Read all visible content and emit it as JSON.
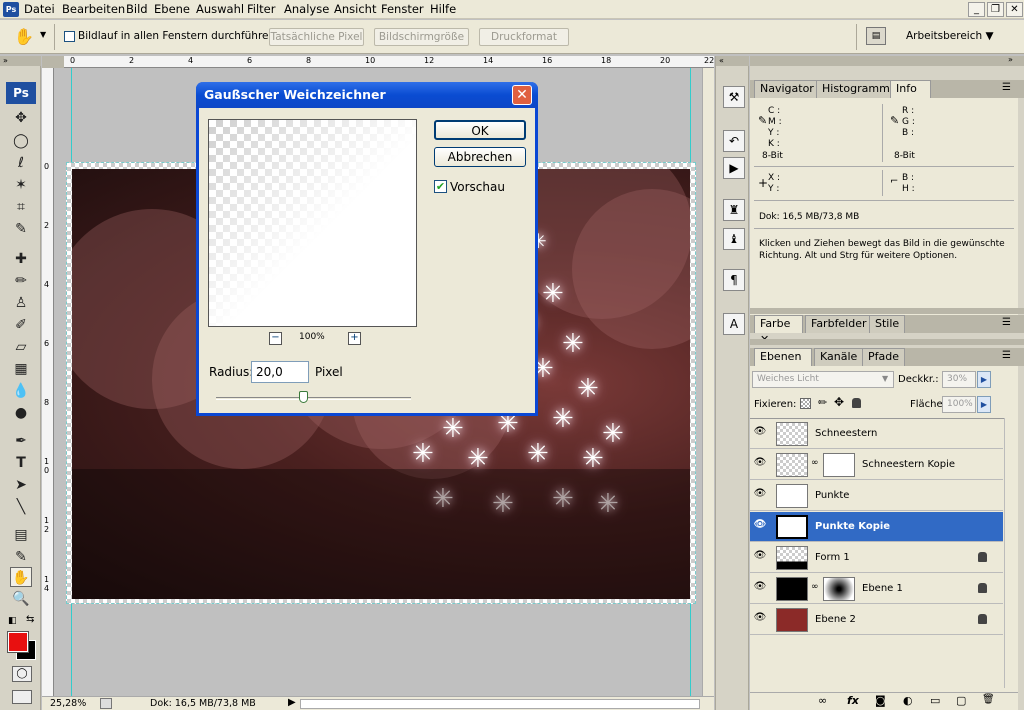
{
  "menubar": {
    "items": [
      "Datei",
      "Bearbeiten",
      "Bild",
      "Ebene",
      "Auswahl",
      "Filter",
      "Analyse",
      "Ansicht",
      "Fenster",
      "Hilfe"
    ],
    "window_buttons": [
      "_",
      "❐",
      "✕"
    ]
  },
  "options": {
    "scroll_all_label": "Bildlauf in allen Fenstern durchführen",
    "buttons": [
      "Tatsächliche Pixel",
      "Bildschirmgröße",
      "Druckformat"
    ],
    "workspace_label": "Arbeitsbereich ▼"
  },
  "rulers": {
    "horizontal": [
      "0",
      "2",
      "4",
      "6",
      "8",
      "10",
      "12",
      "14",
      "16",
      "18",
      "20",
      "22"
    ],
    "vertical": [
      "0",
      "2",
      "4",
      "6",
      "8",
      "1\n0",
      "1\n2",
      "1\n4"
    ]
  },
  "status": {
    "zoom": "25,28%",
    "doc": "Dok: 16,5 MB/73,8 MB"
  },
  "dialog": {
    "title": "Gaußscher Weichzeichner",
    "ok": "OK",
    "cancel": "Abbrechen",
    "preview_label": "Vorschau",
    "preview_checked": true,
    "zoom_minus": "−",
    "zoom_value": "100%",
    "zoom_plus": "+",
    "radius_label": "Radius:",
    "radius_value": "20,0",
    "radius_unit": "Pixel",
    "radius_slider_fraction": 0.45
  },
  "info_panel": {
    "tabs": [
      "Navigator",
      "Histogramm",
      "Info"
    ],
    "cmyk_labels": [
      "C :",
      "M :",
      "Y :",
      "K :"
    ],
    "rgb_labels": [
      "R :",
      "G :",
      "B :"
    ],
    "bit_left": "8-Bit",
    "bit_right": "8-Bit",
    "xy_labels": [
      "X :",
      "Y :"
    ],
    "bh_labels": [
      "B :",
      "H :"
    ],
    "doc": "Dok: 16,5 MB/73,8 MB",
    "hint": "Klicken und Ziehen bewegt das Bild in die gewünschte Richtung. Alt und Strg für weitere Optionen."
  },
  "color_panel": {
    "tabs": [
      "Farbe",
      "Farbfelder",
      "Stile"
    ]
  },
  "layers_panel": {
    "tabs": [
      "Ebenen",
      "Kanäle",
      "Pfade"
    ],
    "blend_mode": "Weiches Licht",
    "opacity_label": "Deckkr.:",
    "opacity_value": "30%",
    "lock_label": "Fixieren:",
    "fill_label": "Fläche:",
    "fill_value": "100%",
    "layers": [
      {
        "name": "Schneestern",
        "selected": false,
        "mask": false,
        "locked": false
      },
      {
        "name": "Schneestern Kopie",
        "selected": false,
        "mask": true,
        "locked": false
      },
      {
        "name": "Punkte",
        "selected": false,
        "mask": false,
        "locked": false
      },
      {
        "name": "Punkte Kopie",
        "selected": true,
        "mask": false,
        "locked": false
      },
      {
        "name": "Form 1",
        "selected": false,
        "mask": false,
        "locked": true
      },
      {
        "name": "Ebene 1",
        "selected": false,
        "mask": true,
        "locked": true
      },
      {
        "name": "Ebene 2",
        "selected": false,
        "mask": false,
        "locked": true
      }
    ],
    "footer_icons": [
      "link-icon",
      "fx-icon",
      "mask-icon",
      "adjustment-icon",
      "folder-icon",
      "new-layer-icon",
      "trash-icon"
    ],
    "footer_glyphs": [
      "∞",
      "fx",
      "◙",
      "◐",
      "▭",
      "▢",
      "🗑"
    ]
  },
  "colors": {
    "foreground": "#e81010",
    "background": "#000000",
    "selection": "#316ac5",
    "dialog_title": "#0a4cd2"
  }
}
